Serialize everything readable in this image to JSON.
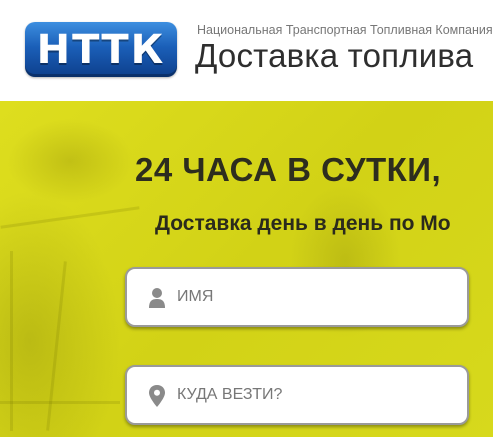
{
  "header": {
    "logo_text": "НТТК",
    "company_name": "Национальная Транспортная Топливная Компания",
    "title": "Доставка топлива"
  },
  "hero": {
    "headline": "24 ЧАСА В СУТКИ,",
    "subline": "Доставка день в день по Мо",
    "form": {
      "name_field": {
        "placeholder": "ИМЯ",
        "value": "",
        "icon": "user-icon"
      },
      "address_field": {
        "placeholder": "КУДА ВЕЗТИ?",
        "value": "",
        "icon": "map-pin-icon"
      }
    }
  },
  "colors": {
    "hero_yellow": "#d8d91a",
    "logo_blue": "#1b5fb8",
    "text_dark": "#2d2d1e"
  }
}
